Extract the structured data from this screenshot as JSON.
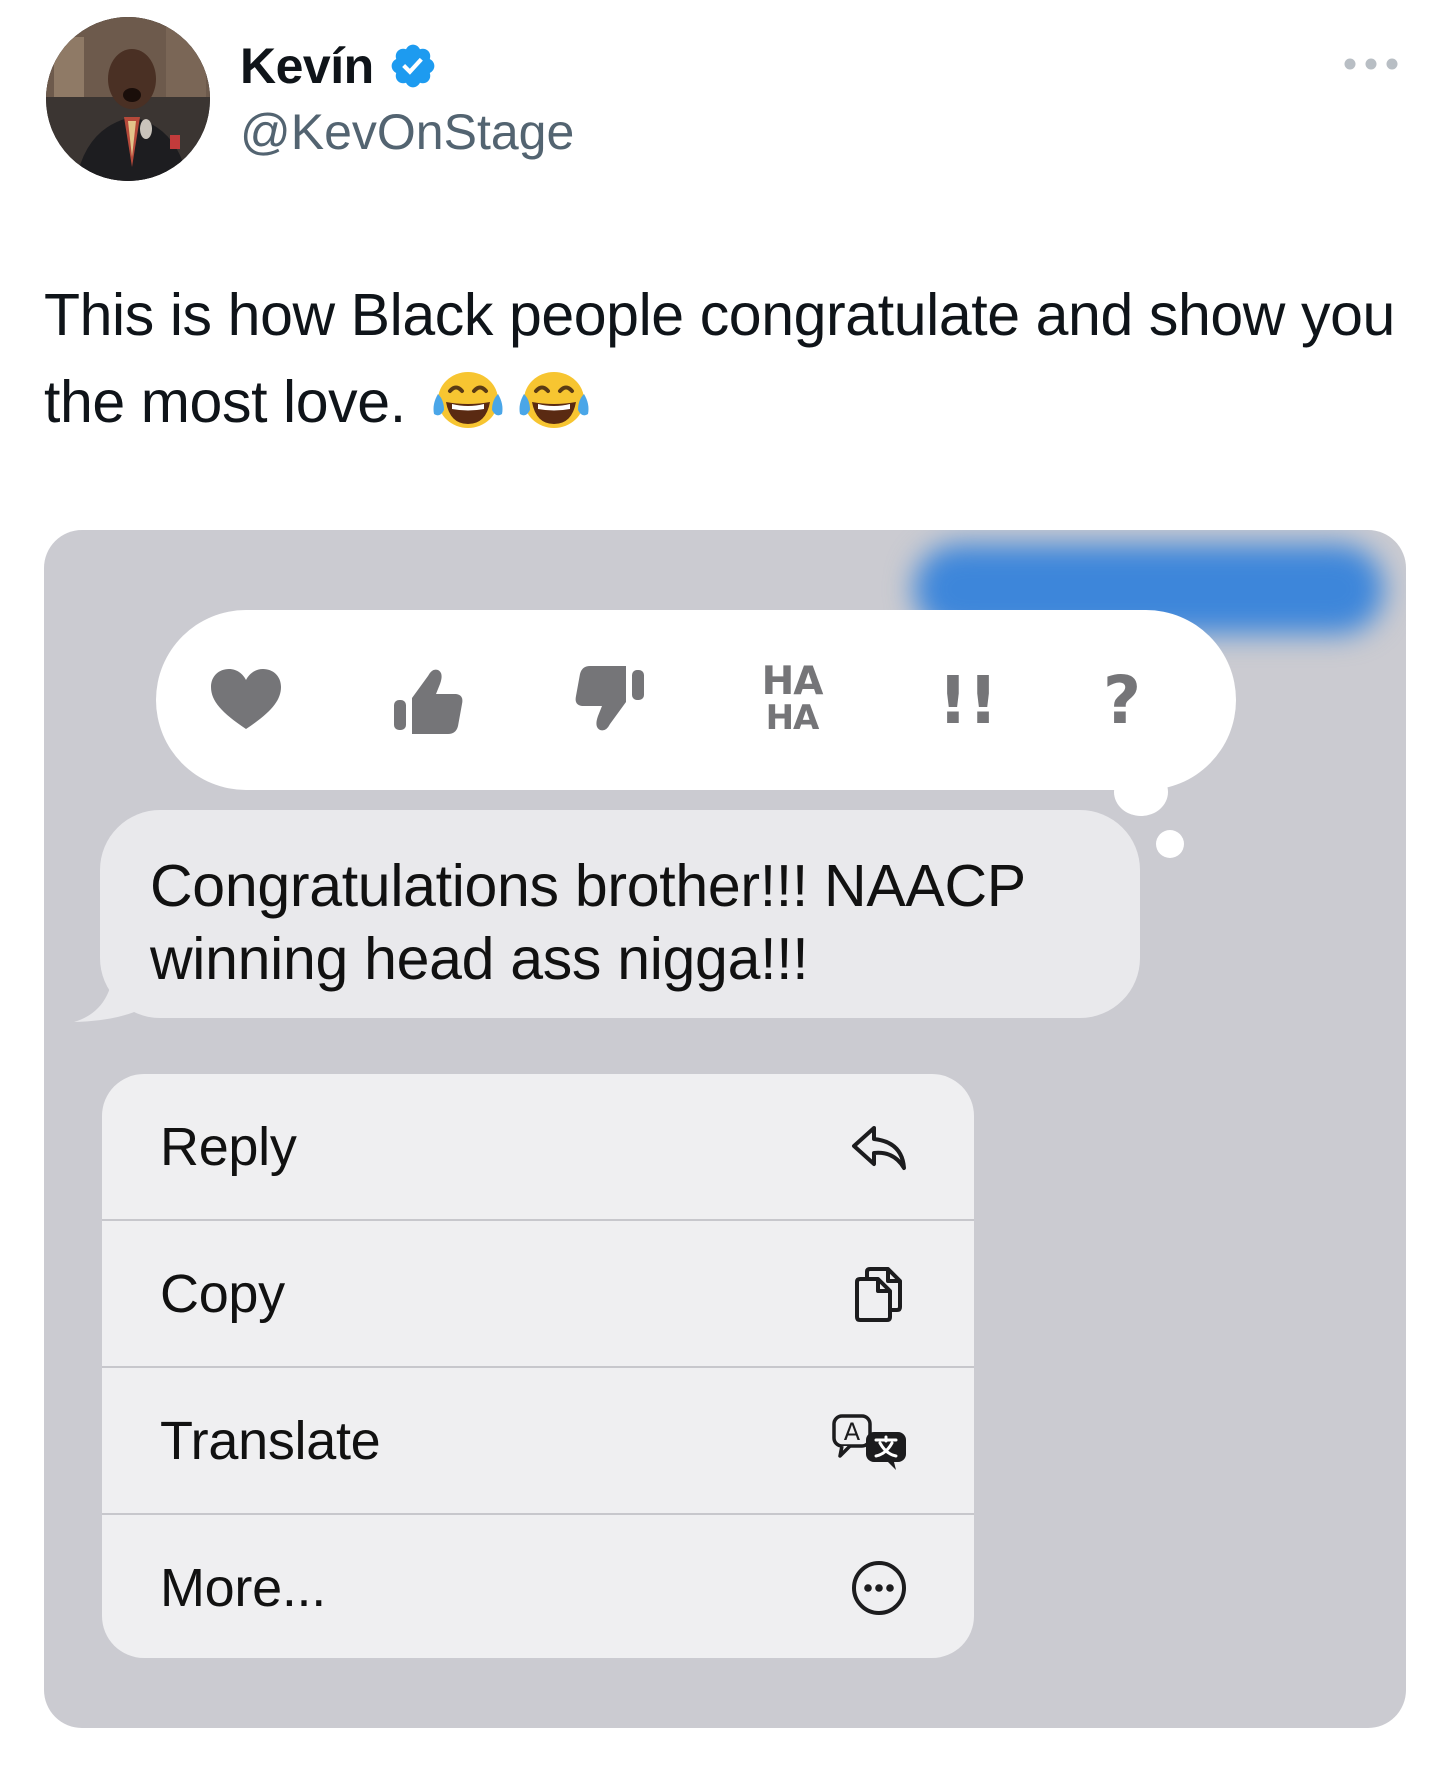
{
  "tweet": {
    "author_name": "Kevín",
    "handle": "@KevOnStage",
    "verified": true,
    "text": "This is how Black people congratulate and show you the most love.",
    "emojis": [
      "face-with-tears-of-joy",
      "face-with-tears-of-joy"
    ]
  },
  "imessage": {
    "tapbacks": [
      {
        "name": "heart"
      },
      {
        "name": "thumbs-up"
      },
      {
        "name": "thumbs-down"
      },
      {
        "name": "haha",
        "line1": "HA",
        "line2": "HA"
      },
      {
        "name": "emphasize",
        "label": "!!"
      },
      {
        "name": "question",
        "label": "?"
      }
    ],
    "message": {
      "line1": "Congratulations brother!!! NAACP",
      "line2": "winning head ass nigga!!!"
    },
    "menu": [
      {
        "label": "Reply",
        "icon": "reply-icon"
      },
      {
        "label": "Copy",
        "icon": "copy-icon"
      },
      {
        "label": "Translate",
        "icon": "translate-icon"
      },
      {
        "label": "More...",
        "icon": "more-circle-icon"
      }
    ]
  },
  "colors": {
    "verified_blue": "#1d9bf0",
    "imessage_blue": "#3d86da",
    "tapback_gray": "#757578",
    "media_background": "#cbcbd1",
    "secondary_text": "#536471"
  }
}
